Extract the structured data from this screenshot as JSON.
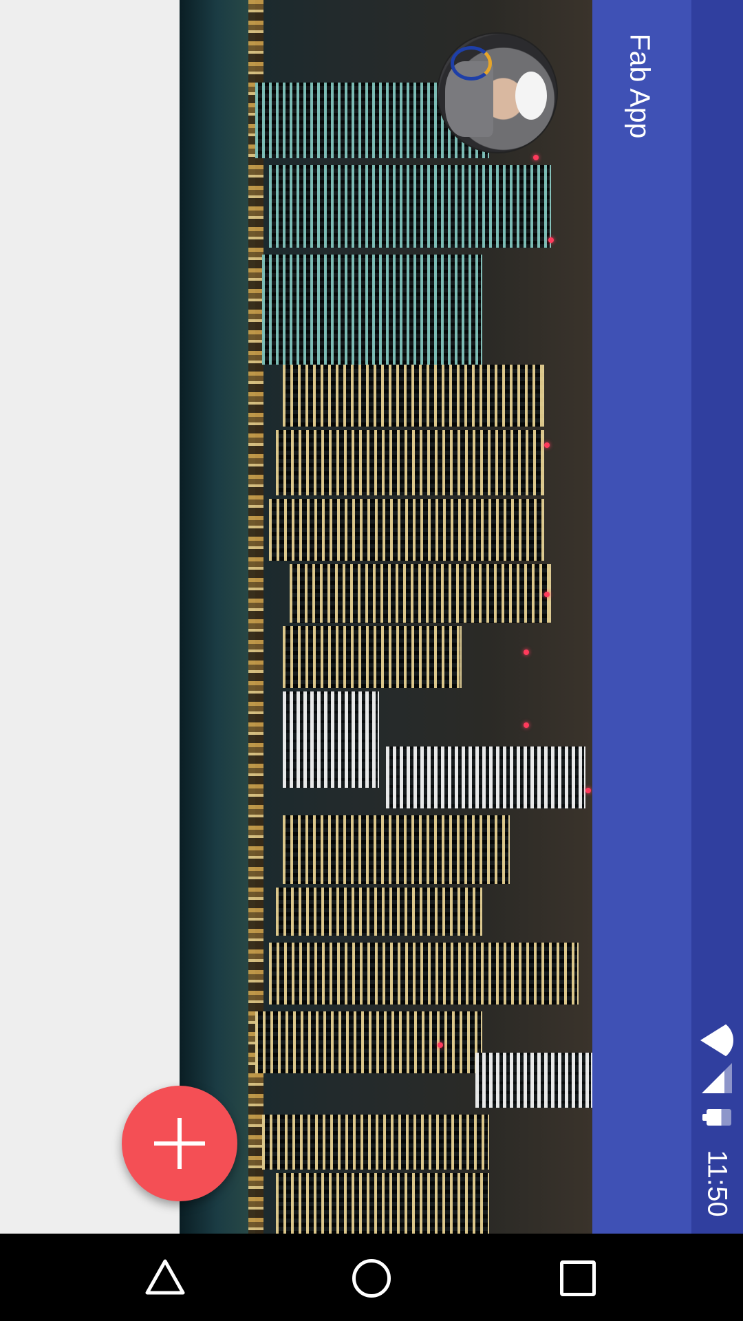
{
  "app": {
    "title": "Fab App"
  },
  "status_bar": {
    "time": "11:50",
    "icons": [
      "wifi-icon",
      "signal-icon",
      "battery-charging-icon"
    ]
  },
  "header_image": {
    "subject": "night-city-skyline-photo"
  },
  "avatar": {
    "icon": "profile-avatar"
  },
  "fab": {
    "icon": "plus-icon",
    "color": "#F44F55"
  },
  "navigation_bar": {
    "buttons": [
      "back-icon",
      "home-icon",
      "recents-icon"
    ]
  },
  "colors": {
    "primary": "#3F51B5",
    "primary_dark": "#303F9F",
    "accent": "#F44F55",
    "background": "#EEEEEE"
  }
}
